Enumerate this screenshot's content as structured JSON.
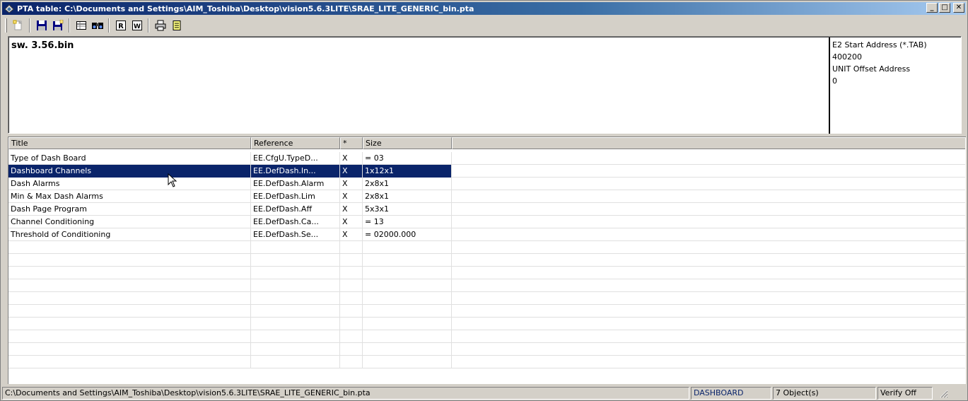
{
  "window": {
    "title": "PTA table: C:\\Documents and Settings\\AIM_Toshiba\\Desktop\\vision5.6.3LITE\\SRAE_LITE_GENERIC_bin.pta",
    "minimize": "_",
    "maximize": "□",
    "close": "✕"
  },
  "toolbar": {
    "icons": [
      "new-document-icon",
      "save-icon",
      "save-as-icon",
      "table-view-icon",
      "find-icon",
      "read-icon",
      "write-icon",
      "print-icon",
      "notes-icon"
    ]
  },
  "info": {
    "filename": "sw. 3.56.bin",
    "e2_label": "E2 Start Address (*.TAB)",
    "e2_value": "400200",
    "unit_label": "UNIT Offset Address",
    "unit_value": "0"
  },
  "grid": {
    "columns": [
      "Title",
      "Reference",
      "*",
      "Size"
    ],
    "rows": [
      {
        "title": "Type of Dash Board",
        "reference": "EE.CfgU.TypeD...",
        "star": "X",
        "size": "= 03"
      },
      {
        "title": "Dashboard Channels",
        "reference": "EE.DefDash.In...",
        "star": "X",
        "size": "1x12x1"
      },
      {
        "title": "Dash Alarms",
        "reference": "EE.DefDash.Alarm",
        "star": "X",
        "size": "2x8x1"
      },
      {
        "title": "Min & Max Dash Alarms",
        "reference": "EE.DefDash.Lim",
        "star": "X",
        "size": "2x8x1"
      },
      {
        "title": "Dash Page Program",
        "reference": "EE.DefDash.Aff",
        "star": "X",
        "size": "5x3x1"
      },
      {
        "title": "Channel Conditioning",
        "reference": "EE.DefDash.Ca...",
        "star": "X",
        "size": "= 13"
      },
      {
        "title": "Threshold of Conditioning",
        "reference": "EE.DefDash.Se...",
        "star": "X",
        "size": "= 02000.000"
      }
    ],
    "selected_index": 1,
    "empty_rows": 10
  },
  "status": {
    "path": "C:\\Documents and Settings\\AIM_Toshiba\\Desktop\\vision5.6.3LITE\\SRAE_LITE_GENERIC_bin.pta",
    "mode": "DASHBOARD",
    "count": "7 Object(s)",
    "verify": "Verify Off"
  },
  "colors": {
    "selection": "#0a246a",
    "titlebar_start": "#0a246a",
    "titlebar_end": "#a6caf0"
  }
}
